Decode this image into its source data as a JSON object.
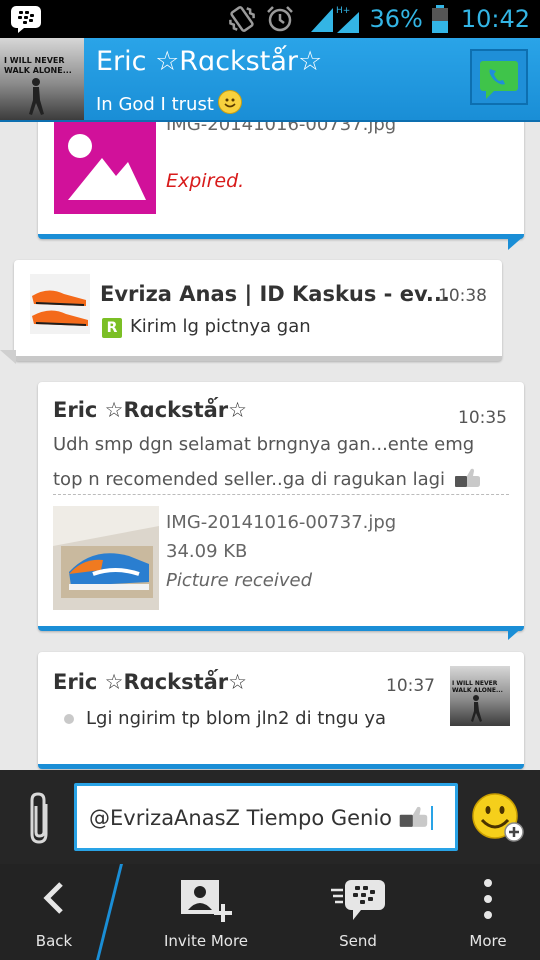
{
  "status_bar": {
    "battery": "36%",
    "time": "10:42"
  },
  "header": {
    "contact_name": "Eric ☆Rɑckstǻr☆",
    "contact_status": "In God I trust",
    "avatar_caption": "I WILL NEVER WALK ALONE..."
  },
  "messages": [
    {
      "file_name": "IMG-20141016-00737.jpg",
      "status": "Expired."
    },
    {
      "sender": "Evriza Anas | ID Kaskus - ev...",
      "time": "10:38",
      "badge": "R",
      "text": "Kirim lg pictnya gan"
    },
    {
      "sender": "Eric ☆Rɑckstǻr☆",
      "time": "10:35",
      "text_line1": "Udh smp dgn selamat brngnya gan...ente emg",
      "text_line2": "top n recomended seller..ga di ragukan lagi",
      "file_name": "IMG-20141016-00737.jpg",
      "file_size": "34.09 KB",
      "file_status": "Picture received"
    },
    {
      "sender": "Eric ☆Rɑckstǻr☆",
      "time": "10:37",
      "text": "Lgi ngirim tp blom jln2 di tngu ya",
      "avatar_caption": "I WILL NEVER WALK ALONE..."
    }
  ],
  "composer": {
    "value": "@EvrizaAnasZ Tiempo Genio"
  },
  "bottom_bar": [
    {
      "label": "Back",
      "icon": "back-chevron-icon"
    },
    {
      "label": "Invite More",
      "icon": "invite-contact-icon"
    },
    {
      "label": "Send",
      "icon": "send-bbm-icon"
    },
    {
      "label": "More",
      "icon": "overflow-dots-icon"
    }
  ],
  "colors": {
    "accent": "#1a8ed6",
    "status_blue": "#33b5e5",
    "expired_red": "#d81b1b",
    "bar_dark": "#232323"
  }
}
